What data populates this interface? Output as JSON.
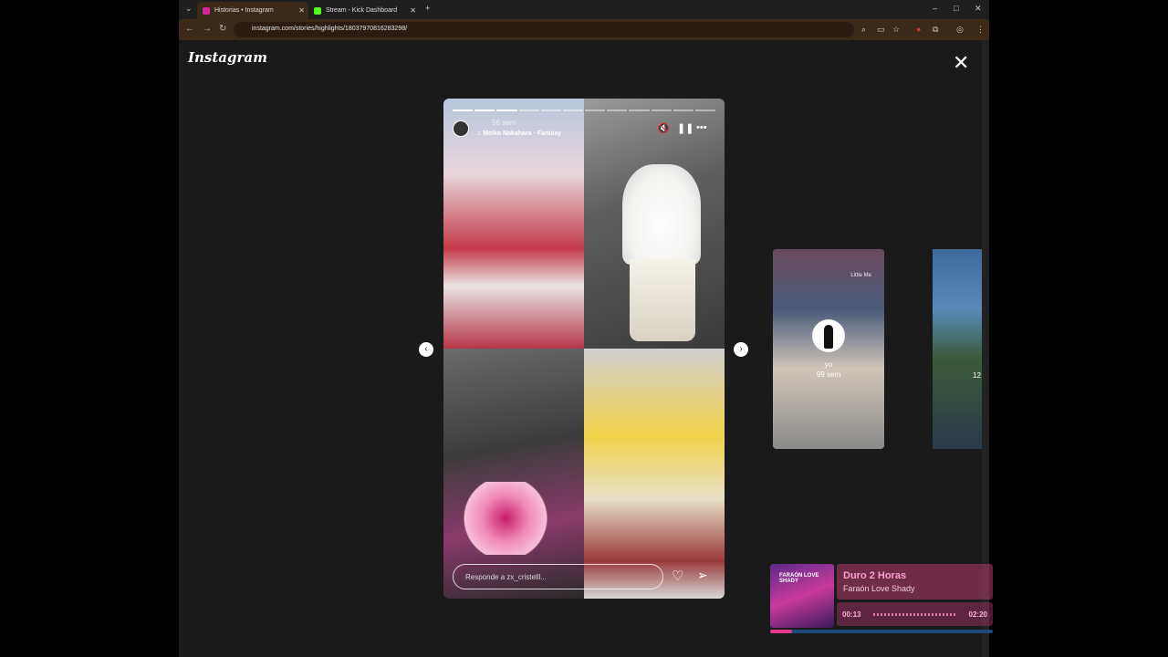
{
  "browser": {
    "tabs": [
      {
        "title": "Historias • Instagram",
        "active": true,
        "favicon_color": "#d6249f"
      },
      {
        "title": "Stream - Kick Dashboard",
        "active": false,
        "favicon_color": "#53fc18"
      }
    ],
    "url": "instagram.com/stories/highlights/18037970816283298/"
  },
  "instagram": {
    "logo": "Instagram",
    "story": {
      "time_ago": "56 sem",
      "song": "Meiko Nakahara · Fantasy",
      "reply_placeholder": "Responde a zx_cristelll...",
      "progress_segments": 12,
      "progress_done": 3
    },
    "next_story": {
      "title": "Little Me",
      "name": "yo",
      "time_ago": "99 sem"
    },
    "next_story_2": {
      "time_ago_partial": "12"
    }
  },
  "music_widget": {
    "title": "Duro 2 Horas",
    "artist": "Faraón Love Shady",
    "album_text": "FARAÓN LOVE SHADY",
    "current_time": "00:13",
    "total_time": "02:20",
    "progress": 0.1
  }
}
